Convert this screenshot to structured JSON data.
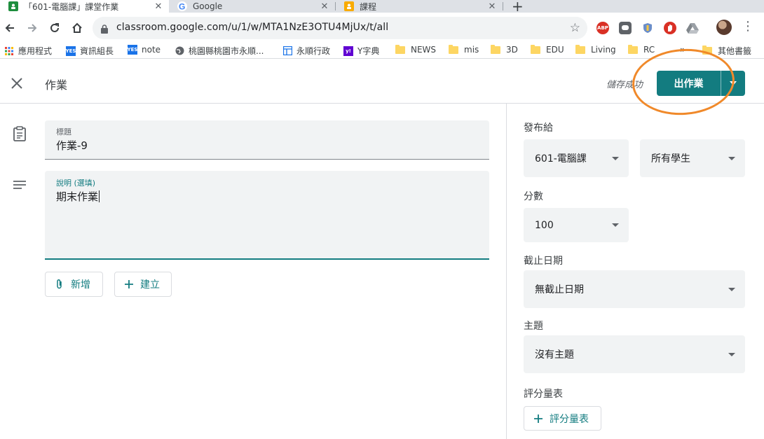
{
  "browser": {
    "tabs": [
      {
        "title": "「601-電腦課」課堂作業",
        "active": true
      },
      {
        "title": "Google",
        "active": false
      },
      {
        "title": "課程",
        "active": false
      }
    ],
    "url": "classroom.google.com/u/1/w/MTA1NzE3OTU4MjUx/t/all",
    "extensions": [
      "abp-icon",
      "line-icon",
      "shield-extension-icon",
      "stop-icon",
      "drive-icon"
    ],
    "bookmarks": [
      {
        "label": "應用程式",
        "icon": "apps-grid-icon"
      },
      {
        "label": "資訊組長",
        "icon": "yes-badge-icon"
      },
      {
        "label": "note",
        "icon": "yes-badge-icon"
      },
      {
        "label": "桃園縣桃園市永順...",
        "icon": "globe-icon"
      },
      {
        "label": "永順行政",
        "icon": "layout-icon"
      },
      {
        "label": "Y字典",
        "icon": "yahoo-icon"
      },
      {
        "label": "NEWS",
        "icon": "folder-icon"
      },
      {
        "label": "mis",
        "icon": "folder-icon"
      },
      {
        "label": "3D",
        "icon": "folder-icon"
      },
      {
        "label": "EDU",
        "icon": "folder-icon"
      },
      {
        "label": "Living",
        "icon": "folder-icon"
      },
      {
        "label": "RC",
        "icon": "folder-icon"
      },
      {
        "label": "»",
        "icon": ""
      },
      {
        "label": "其他書籤",
        "icon": "folder-icon"
      }
    ],
    "badge_yes": "YES",
    "badge_abp": "ABP"
  },
  "header": {
    "title": "作業",
    "save_status": "儲存成功",
    "assign_label": "出作業"
  },
  "form": {
    "title_label": "標題",
    "title_value": "作業-9",
    "desc_label": "說明 (選填)",
    "desc_value": "期末作業",
    "add_label": "新增",
    "create_label": "建立"
  },
  "settings": {
    "for_label": "發布給",
    "class_value": "601-電腦課",
    "students_value": "所有學生",
    "points_label": "分數",
    "points_value": "100",
    "due_label": "截止日期",
    "due_value": "無截止日期",
    "topic_label": "主題",
    "topic_value": "沒有主題",
    "rubric_label": "評分量表",
    "rubric_button": "評分量表"
  },
  "colors": {
    "accent": "#137c80",
    "highlight": "#f0892a"
  }
}
